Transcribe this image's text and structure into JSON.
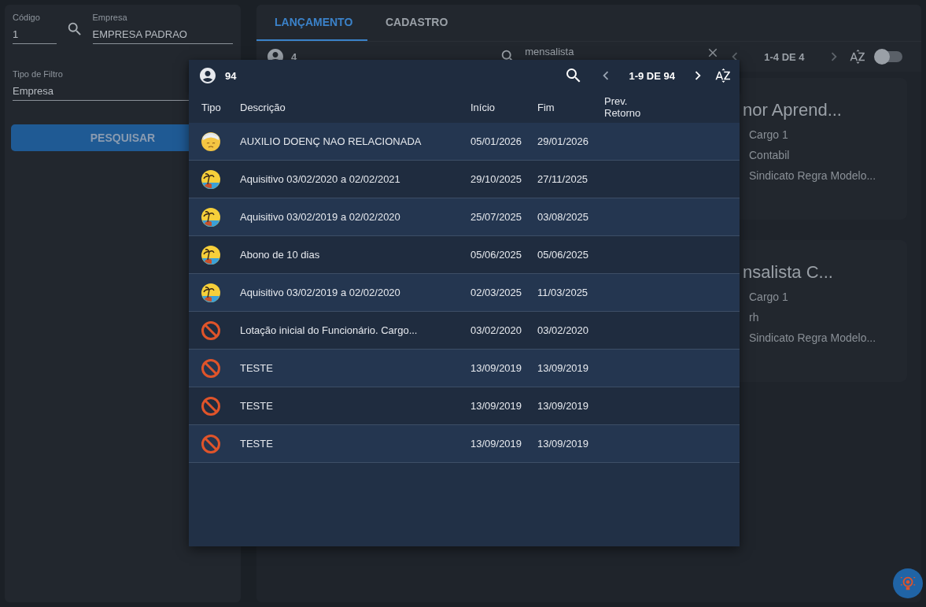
{
  "filters": {
    "codigo": {
      "label": "Código",
      "value": "1"
    },
    "empresa": {
      "label": "Empresa",
      "value": "EMPRESA PADRAO"
    },
    "tipo_filtro": {
      "label": "Tipo de Filtro",
      "value": "Empresa"
    },
    "search_button": "PESQUISAR"
  },
  "tabs": [
    {
      "label": "LANÇAMENTO",
      "selected": true
    },
    {
      "label": "CADASTRO",
      "selected": false
    }
  ],
  "toolbar": {
    "count": "4",
    "search": {
      "value": "mensalista"
    },
    "pagination": "1-4 DE 4",
    "toggle": {
      "on": false
    }
  },
  "cards": [
    {
      "title": "nor Aprend...",
      "lines": [
        "Cargo 1",
        "Contabil",
        "Sindicato Regra Modelo..."
      ]
    },
    {
      "title": "nsalista C...",
      "lines": [
        "Cargo 1",
        "rh",
        "Sindicato Regra Modelo..."
      ]
    }
  ],
  "popup": {
    "count": "94",
    "pagination": "1-9 DE 94",
    "columns": [
      "Tipo",
      "Descrição",
      "Início",
      "Fim",
      "Prev. Retorno"
    ],
    "rows": [
      {
        "kind": "sick",
        "description": "AUXILIO DOENÇ NAO RELACIONADA",
        "start": "05/01/2026",
        "end": "29/01/2026"
      },
      {
        "kind": "vacation",
        "description": "Aquisitivo 03/02/2020 a 02/02/2021",
        "start": "29/10/2025",
        "end": "27/11/2025"
      },
      {
        "kind": "vacation",
        "description": "Aquisitivo 03/02/2019 a 02/02/2020",
        "start": "25/07/2025",
        "end": "03/08/2025"
      },
      {
        "kind": "vacation",
        "description": "Abono de 10 dias",
        "start": "05/06/2025",
        "end": "05/06/2025"
      },
      {
        "kind": "vacation",
        "description": "Aquisitivo 03/02/2019 a 02/02/2020",
        "start": "02/03/2025",
        "end": "11/03/2025"
      },
      {
        "kind": "blocked",
        "description": "Lotação inicial do Funcionário. Cargo...",
        "start": "03/02/2020",
        "end": "03/02/2020"
      },
      {
        "kind": "blocked",
        "description": "TESTE",
        "start": "13/09/2019",
        "end": "13/09/2019"
      },
      {
        "kind": "blocked",
        "description": "TESTE",
        "start": "13/09/2019",
        "end": "13/09/2019"
      },
      {
        "kind": "blocked",
        "description": "TESTE",
        "start": "13/09/2019",
        "end": "13/09/2019"
      }
    ]
  }
}
